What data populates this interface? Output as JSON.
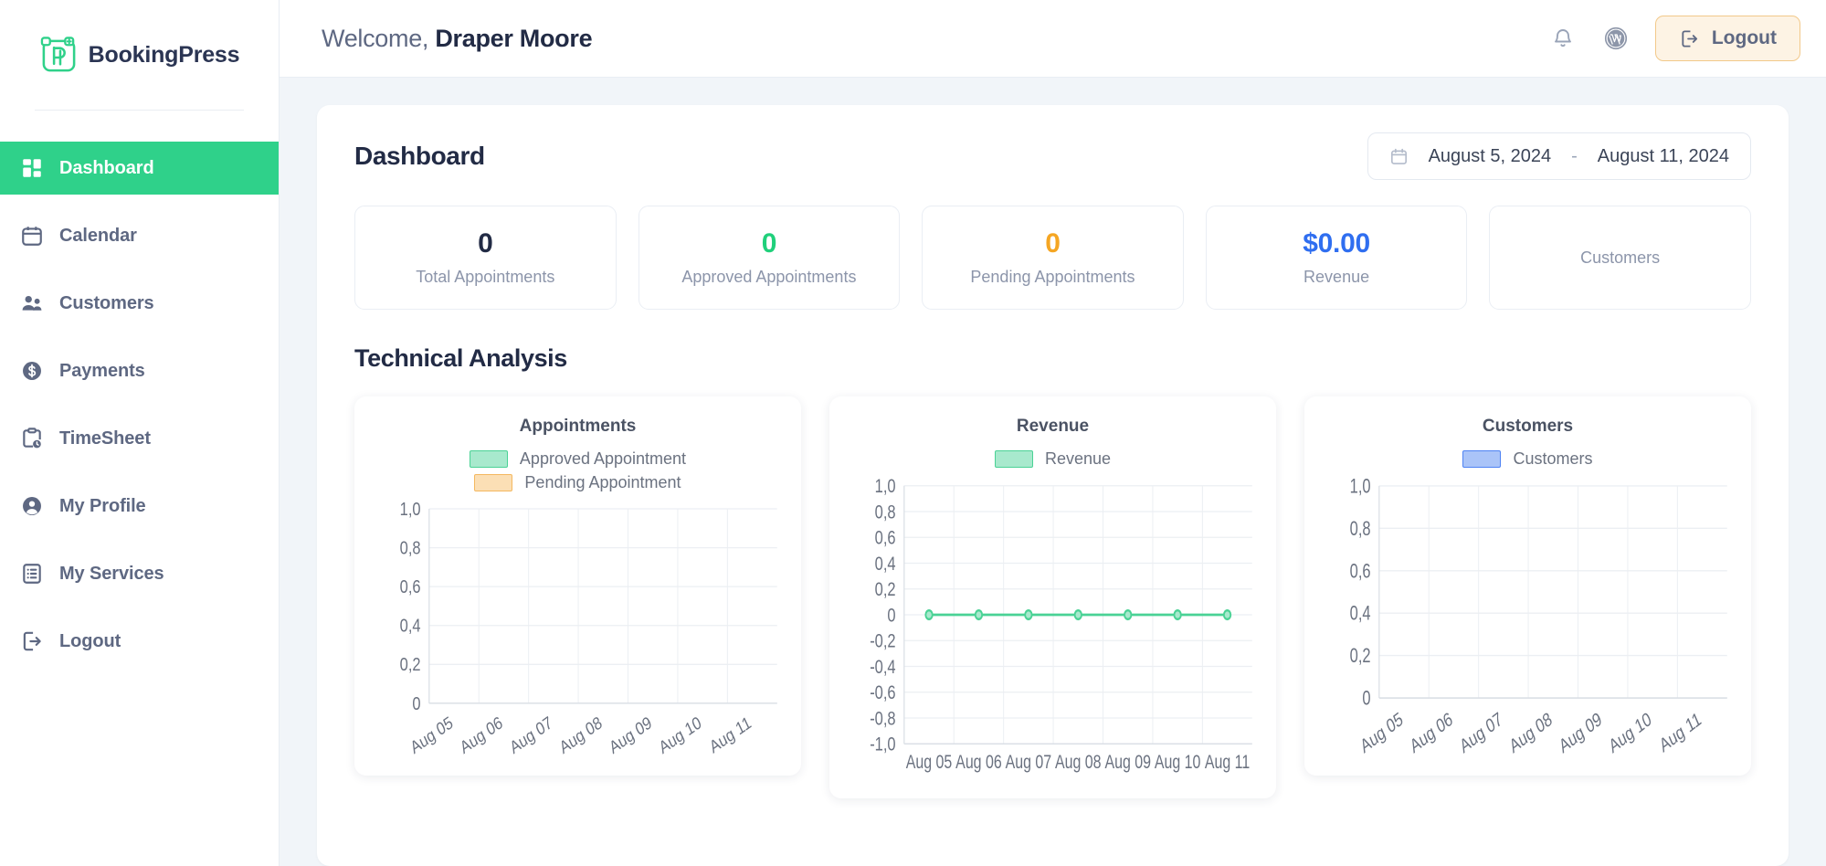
{
  "brand": {
    "name": "BookingPress",
    "logo_icon": "bookingpress-logo-icon",
    "accent": "#2fd18a"
  },
  "sidebar": {
    "items": [
      {
        "label": "Dashboard",
        "icon": "grid-icon",
        "active": true
      },
      {
        "label": "Calendar",
        "icon": "calendar-icon",
        "active": false
      },
      {
        "label": "Customers",
        "icon": "users-icon",
        "active": false
      },
      {
        "label": "Payments",
        "icon": "dollar-circle-icon",
        "active": false
      },
      {
        "label": "TimeSheet",
        "icon": "clipboard-clock-icon",
        "active": false
      },
      {
        "label": "My Profile",
        "icon": "user-circle-icon",
        "active": false
      },
      {
        "label": "My Services",
        "icon": "clipboard-list-icon",
        "active": false
      },
      {
        "label": "Logout",
        "icon": "logout-icon",
        "active": false
      }
    ]
  },
  "topbar": {
    "welcome_prefix": "Welcome, ",
    "user_name": "Draper Moore",
    "bell_icon": "bell-icon",
    "wordpress_icon": "wordpress-icon",
    "logout_label": "Logout",
    "logout_icon": "logout-icon"
  },
  "dashboard": {
    "title": "Dashboard",
    "date_range": {
      "calendar_icon": "calendar-icon",
      "start": "August 5, 2024",
      "separator": "-",
      "end": "August 11, 2024"
    },
    "stats": [
      {
        "value": "0",
        "label": "Total Appointments",
        "color": "#222b45"
      },
      {
        "value": "0",
        "label": "Approved Appointments",
        "color": "#20d07b"
      },
      {
        "value": "0",
        "label": "Pending Appointments",
        "color": "#f5a623"
      },
      {
        "value": "$0.00",
        "label": "Revenue",
        "color": "#2f6ef0"
      },
      {
        "value": "",
        "label": "Customers",
        "color": "#8c95aa"
      }
    ],
    "technical_analysis_title": "Technical Analysis"
  },
  "chart_data": [
    {
      "type": "bar",
      "title": "Appointments",
      "categories": [
        "Aug 05",
        "Aug 06",
        "Aug 07",
        "Aug 08",
        "Aug 09",
        "Aug 10",
        "Aug 11"
      ],
      "series": [
        {
          "name": "Approved Appointment",
          "values": [
            0,
            0,
            0,
            0,
            0,
            0,
            0
          ],
          "color": "#a8e9cd",
          "border": "#4ad295"
        },
        {
          "name": "Pending Appointment",
          "values": [
            0,
            0,
            0,
            0,
            0,
            0,
            0
          ],
          "color": "#fbdfb5",
          "border": "#f4b860"
        }
      ],
      "yticks": [
        "1,0",
        "0,8",
        "0,6",
        "0,4",
        "0,2",
        "0"
      ],
      "ylim": [
        0,
        1
      ],
      "xlabel": "",
      "ylabel": "",
      "grid": true,
      "legend_position": "top",
      "xtick_rotation": -30
    },
    {
      "type": "line",
      "title": "Revenue",
      "categories": [
        "Aug 05",
        "Aug 06",
        "Aug 07",
        "Aug 08",
        "Aug 09",
        "Aug 10",
        "Aug 11"
      ],
      "series": [
        {
          "name": "Revenue",
          "values": [
            0,
            0,
            0,
            0,
            0,
            0,
            0
          ],
          "color": "#a8e9cd",
          "border": "#4ad295"
        }
      ],
      "yticks": [
        "1,0",
        "0,8",
        "0,6",
        "0,4",
        "0,2",
        "0",
        "-0,2",
        "-0,4",
        "-0,6",
        "-0,8",
        "-1,0"
      ],
      "ylim": [
        -1,
        1
      ],
      "xlabel": "",
      "ylabel": "",
      "grid": true,
      "legend_position": "top",
      "xtick_rotation": 0
    },
    {
      "type": "bar",
      "title": "Customers",
      "categories": [
        "Aug 05",
        "Aug 06",
        "Aug 07",
        "Aug 08",
        "Aug 09",
        "Aug 10",
        "Aug 11"
      ],
      "series": [
        {
          "name": "Customers",
          "values": [
            0,
            0,
            0,
            0,
            0,
            0,
            0
          ],
          "color": "#aac4f8",
          "border": "#4d82f3"
        }
      ],
      "yticks": [
        "1,0",
        "0,8",
        "0,6",
        "0,4",
        "0,2",
        "0"
      ],
      "ylim": [
        0,
        1
      ],
      "xlabel": "",
      "ylabel": "",
      "grid": true,
      "legend_position": "top",
      "xtick_rotation": -30
    }
  ]
}
